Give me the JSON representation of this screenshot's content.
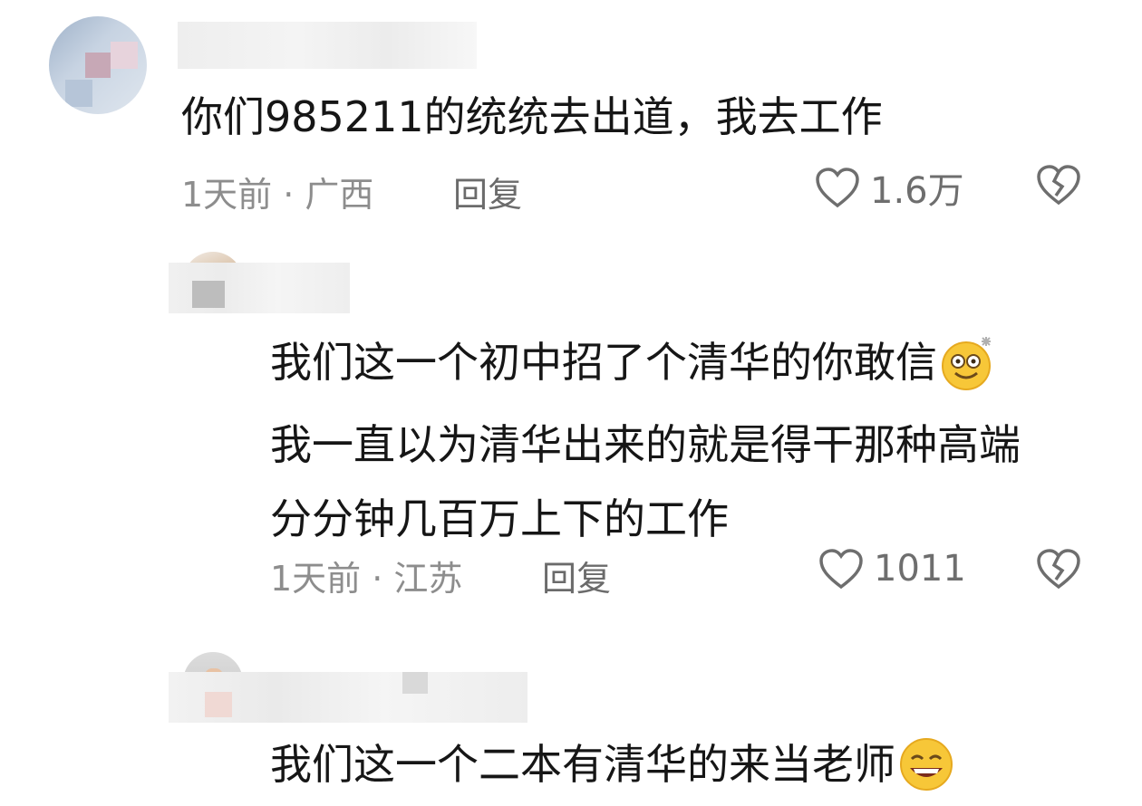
{
  "comments": [
    {
      "text_lines": [
        "你们985211的统统去出道，我去工作"
      ],
      "meta": "1天前 · 广西",
      "reply_label": "回复",
      "like_count": "1.6万"
    },
    {
      "text_lines": [
        "我们这一个初中招了个清华的你敢信",
        "我一直以为清华出来的就是得干那种高端",
        "分分钟几百万上下的工作"
      ],
      "meta": "1天前 · 江苏",
      "reply_label": "回复",
      "like_count": "1011"
    },
    {
      "text_lines": [
        "我们这一个二本有清华的来当老师"
      ]
    }
  ],
  "icons": {
    "like": "heart-outline-icon",
    "dislike": "broken-heart-icon",
    "emoji_dizzy": "dizzy-smile-emoji",
    "emoji_grin": "grin-emoji"
  },
  "colors": {
    "text": "#161616",
    "meta": "#8d8d8d",
    "emoji_yellow": "#f7c738"
  }
}
